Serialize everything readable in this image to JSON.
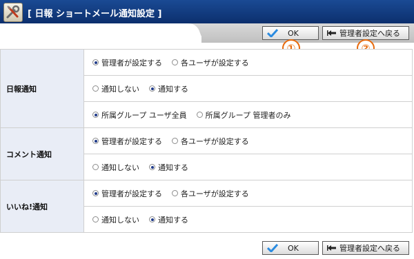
{
  "window": {
    "title": "[ 日報 ショートメール通知設定 ]"
  },
  "toolbar": {
    "ok_label": "OK",
    "back_label": "管理者設定へ戻る",
    "marker_1": "①",
    "marker_2": "②"
  },
  "sections": [
    {
      "label": "日報通知",
      "rows": [
        [
          {
            "label": "管理者が設定する",
            "checked": true
          },
          {
            "label": "各ユーザが設定する",
            "checked": false
          }
        ],
        [
          {
            "label": "通知しない",
            "checked": false
          },
          {
            "label": "通知する",
            "checked": true
          }
        ],
        [
          {
            "label": "所属グループ ユーザ全員",
            "checked": true
          },
          {
            "label": "所属グループ 管理者のみ",
            "checked": false
          }
        ]
      ]
    },
    {
      "label": "コメント通知",
      "rows": [
        [
          {
            "label": "管理者が設定する",
            "checked": true
          },
          {
            "label": "各ユーザが設定する",
            "checked": false
          }
        ],
        [
          {
            "label": "通知しない",
            "checked": false
          },
          {
            "label": "通知する",
            "checked": true
          }
        ]
      ]
    },
    {
      "label": "いいね!通知",
      "rows": [
        [
          {
            "label": "管理者が設定する",
            "checked": true
          },
          {
            "label": "各ユーザが設定する",
            "checked": false
          }
        ],
        [
          {
            "label": "通知しない",
            "checked": false
          },
          {
            "label": "通知する",
            "checked": true
          }
        ]
      ]
    }
  ],
  "colors": {
    "title_bar": "#0c2f6d",
    "label_bg": "#e9edf6",
    "marker": "#e86a0c",
    "ok_check": "#2a8be0"
  }
}
